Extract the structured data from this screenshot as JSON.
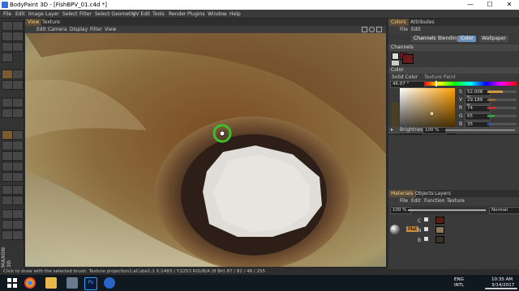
{
  "window": {
    "title": "BodyPaint 3D - [FishBPV_01.c4d *]",
    "minimize": "—",
    "maximize": "☐",
    "close": "✕"
  },
  "menubar": [
    "File",
    "Edit",
    "Image",
    "Layer",
    "Select",
    "Filter",
    "Select Geometry",
    "UV Edit",
    "Tools",
    "Render",
    "Plugins",
    "Window",
    "Help"
  ],
  "viewport": {
    "tabs": [
      "View",
      "Texture"
    ],
    "menu": [
      "Edit",
      "Camera",
      "Display",
      "Filter",
      "View"
    ],
    "icons": [
      "move-view-icon",
      "rotate-view-icon",
      "zoom-view-icon",
      "toggle-layout-icon"
    ]
  },
  "right_top": {
    "tabs": [
      "Colors",
      "Attributes"
    ],
    "menu": [
      "File",
      "Edit"
    ],
    "pills": [
      "Channels",
      "Blending",
      "Color",
      "Wallpaper"
    ],
    "channels_header": "Channels",
    "color_header": "Color",
    "solid_color": "Solid Color",
    "texture_paint": "Texture Paint",
    "hue_value": "46.07 °",
    "sliders": [
      {
        "label": "S",
        "value": "52.008 %",
        "fill": 0.52,
        "color": "#d29a3a"
      },
      {
        "label": "V",
        "value": "29.189 %",
        "fill": 0.29,
        "color": "#8a6a3a"
      },
      {
        "label": "R",
        "value": "74",
        "fill": 0.29,
        "color": "#c03030"
      },
      {
        "label": "G",
        "value": "65",
        "fill": 0.25,
        "color": "#30a040"
      },
      {
        "label": "B",
        "value": "35",
        "fill": 0.14,
        "color": "#3050c0"
      }
    ],
    "brightness_label": "Brightness",
    "brightness_value": "100 %",
    "swatch_color": "#4a4123"
  },
  "right_bottom": {
    "tabs": [
      "Materials",
      "Objects",
      "Layers"
    ],
    "menu": [
      "File",
      "Edit",
      "Function",
      "Texture"
    ],
    "opacity": "100 %",
    "blend_mode": "Normal",
    "material_label": "Mat",
    "row_marks": [
      "C",
      "N",
      "B"
    ]
  },
  "statusbar": "Click to draw with the selected brush. Texture projection1:aCube1:1  X:1483 / Y:2253 R/G/B/A (8 Bit) 87 / 82 / 48 / 255",
  "vertical_brand": "MAXON 3D",
  "taskbar": {
    "apps": [
      "windows-icon",
      "chrome-icon",
      "explorer-icon",
      "gallery-icon",
      "photoshop-icon",
      "cinema4d-icon",
      "firefox-icon"
    ],
    "ps_label": "Ps",
    "lang_top": "ENG",
    "lang_bottom": "INTL",
    "time": "10:35 AM",
    "date": "3/14/2017"
  }
}
